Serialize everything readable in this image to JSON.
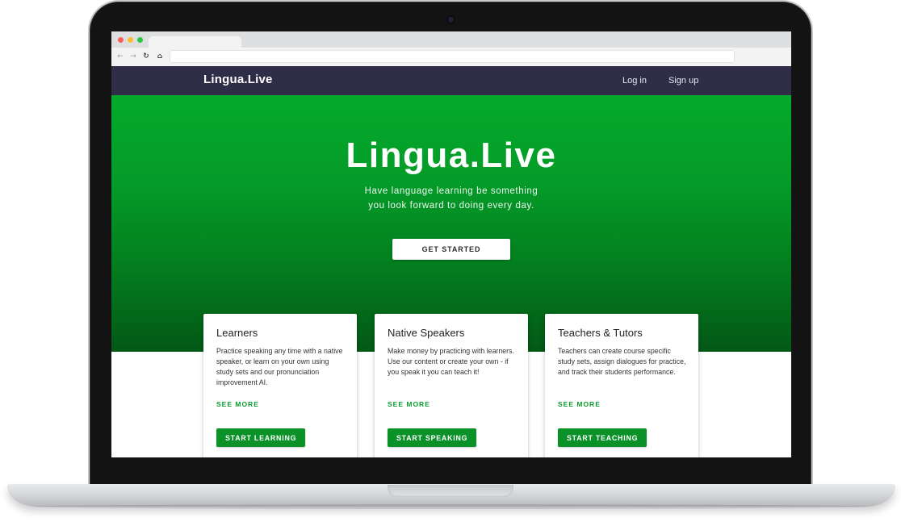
{
  "site": {
    "brand": "Lingua.Live",
    "nav": {
      "login": "Log in",
      "signup": "Sign up"
    }
  },
  "hero": {
    "title": "Lingua.Live",
    "subtitle_line1": "Have language learning be something",
    "subtitle_line2": "you look forward to doing every day.",
    "cta": "GET STARTED"
  },
  "cards": [
    {
      "title": "Learners",
      "text": "Practice speaking any time with a native speaker, or learn on your own using study sets and our pronunciation improvement AI.",
      "more": "SEE MORE",
      "button": "START LEARNING"
    },
    {
      "title": "Native Speakers",
      "text": "Make money by practicing with learners. Use our content or create your own - if you speak it you can teach it!",
      "more": "SEE MORE",
      "button": "START SPEAKING"
    },
    {
      "title": "Teachers & Tutors",
      "text": "Teachers can create course specific study sets, assign dialogues for practice, and track their students performance.",
      "more": "SEE MORE",
      "button": "START TEACHING"
    }
  ],
  "icons": {
    "back": "arrow-left-icon",
    "forward": "arrow-right-icon",
    "reload": "reload-icon",
    "home": "home-icon"
  },
  "colors": {
    "navbar": "#2f2d47",
    "hero_top": "#05aa2b",
    "hero_bottom": "#035816",
    "accent": "#0a9127"
  }
}
